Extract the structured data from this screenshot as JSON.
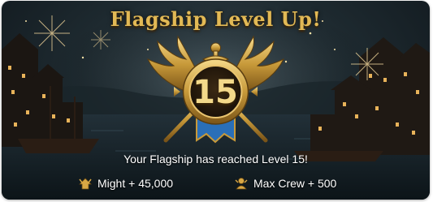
{
  "popup": {
    "title": "Flagship Level Up!",
    "level": "15",
    "message": "Your Flagship has reached Level 15!"
  },
  "rewards": [
    {
      "icon": "might-icon",
      "label": "Might + 45,000"
    },
    {
      "icon": "crew-icon",
      "label": "Max Crew + 500"
    }
  ],
  "colors": {
    "title_gold": "#e2b955",
    "emblem_gold": "#c89a3a",
    "ribbon_blue": "#2a6fb8"
  }
}
